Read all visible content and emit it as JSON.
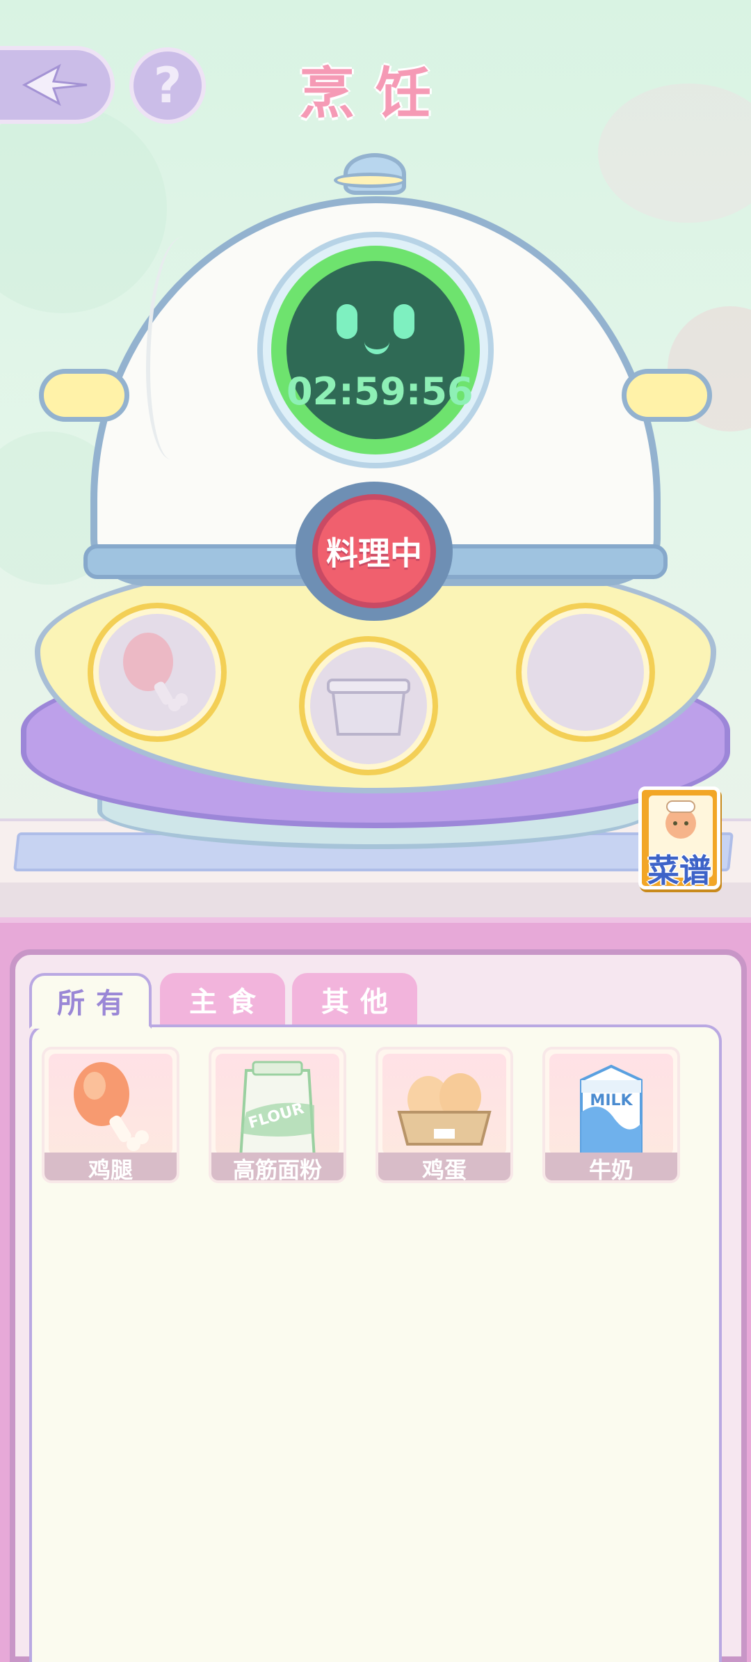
{
  "header": {
    "title": "烹饪",
    "help_symbol": "?"
  },
  "machine": {
    "timer": "02:59:56",
    "status_button": "料理中",
    "slots": [
      "chicken-leg",
      "container",
      "empty"
    ]
  },
  "recipe_button": {
    "label": "菜谱"
  },
  "tabs": [
    {
      "label": "所有",
      "active": true
    },
    {
      "label": "主食",
      "active": false
    },
    {
      "label": "其他",
      "active": false
    }
  ],
  "ingredients": [
    {
      "name": "鸡腿",
      "icon": "chicken-leg-icon"
    },
    {
      "name": "高筋面粉",
      "icon": "flour-bag-icon"
    },
    {
      "name": "鸡蛋",
      "icon": "eggs-icon"
    },
    {
      "name": "牛奶",
      "icon": "milk-carton-icon"
    }
  ],
  "item_labels": {
    "flour": "FLOUR",
    "milk": "MILK"
  },
  "colors": {
    "title": "#f59ab5",
    "timer_ring": "#6ee36e",
    "cook_button": "#f0606e",
    "tab_active_text": "#9a87d6"
  }
}
